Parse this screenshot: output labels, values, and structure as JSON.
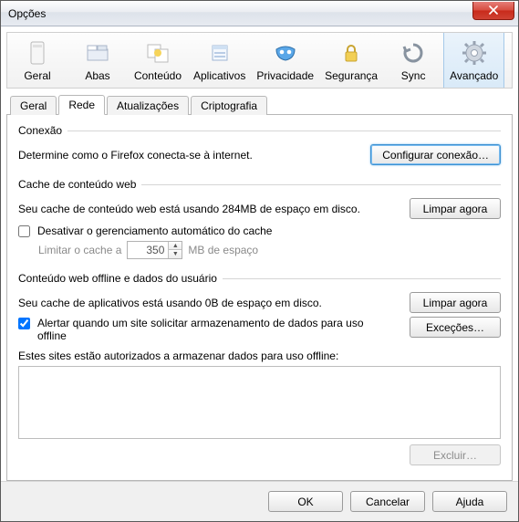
{
  "window": {
    "title": "Opções"
  },
  "toolbar": {
    "items": [
      {
        "label": "Geral"
      },
      {
        "label": "Abas"
      },
      {
        "label": "Conteúdo"
      },
      {
        "label": "Aplicativos"
      },
      {
        "label": "Privacidade"
      },
      {
        "label": "Segurança"
      },
      {
        "label": "Sync"
      },
      {
        "label": "Avançado"
      }
    ],
    "selected_index": 7
  },
  "tabs": {
    "items": [
      {
        "label": "Geral"
      },
      {
        "label": "Rede"
      },
      {
        "label": "Atualizações"
      },
      {
        "label": "Criptografia"
      }
    ],
    "active_index": 1
  },
  "connection": {
    "heading": "Conexão",
    "description": "Determine como o Firefox conecta-se à internet.",
    "configure_btn": "Configurar conexão…"
  },
  "webcache": {
    "heading": "Cache de conteúdo web",
    "status": "Seu cache de conteúdo web está usando 284MB de espaço em disco.",
    "clear_btn": "Limpar agora",
    "disable_auto_label": "Desativar o gerenciamento automático do cache",
    "disable_auto_checked": false,
    "limit_prefix": "Limitar o cache a",
    "limit_value": "350",
    "limit_suffix": "MB de espaço"
  },
  "offline": {
    "heading": "Conteúdo web offline e dados do usuário",
    "status": "Seu cache de aplicativos está usando 0B de espaço em disco.",
    "clear_btn": "Limpar agora",
    "alert_label": "Alertar quando um site solicitar armazenamento de dados para uso offline",
    "alert_checked": true,
    "exceptions_btn": "Exceções…",
    "list_label": "Estes sites estão autorizados a armazenar dados para uso offline:",
    "remove_btn": "Excluir…"
  },
  "footer": {
    "ok": "OK",
    "cancel": "Cancelar",
    "help": "Ajuda"
  }
}
